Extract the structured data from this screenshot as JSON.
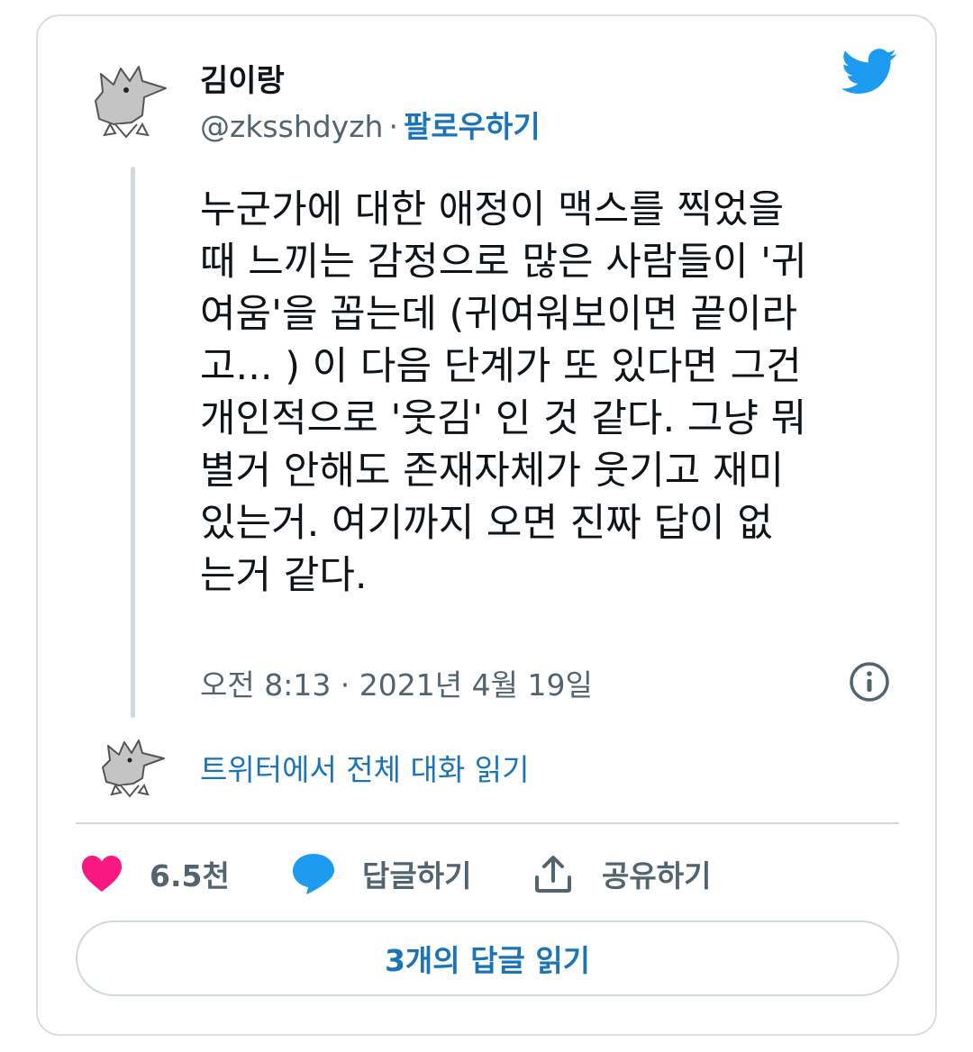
{
  "user": {
    "name": "김이랑",
    "handle": "@zksshdyzh",
    "separator": "·",
    "follow_label": "팔로우하기"
  },
  "tweet": {
    "lines": [
      "누군가에 대한 애정이 맥스를 찍었을",
      "때 느끼는 감정으로 많은 사람들이 '귀",
      "여움'을 꼽는데 (귀여워보이면 끝이라",
      "고... ) 이 다음 단계가 또  있다면 그건",
      "개인적으로 '웃김' 인 것 같다. 그냥 뭐",
      "별거 안해도 존재자체가 웃기고 재미",
      "있는거. 여기까지 오면 진짜 답이 없",
      "는거 같다."
    ],
    "timestamp": "오전 8:13 · 2021년 4월 19일"
  },
  "read_conversation_label": "트위터에서 전체 대화 읽기",
  "actions": {
    "like_count": "6.5천",
    "reply_label": "답글하기",
    "share_label": "공유하기"
  },
  "read_replies_label": "3개의 답글 읽기",
  "colors": {
    "accent": "#1b74b8",
    "twitter_blue": "#1d9bf0",
    "like_pink": "#f91880",
    "secondary_text": "#536471",
    "border": "#cfd9de"
  },
  "icons": {
    "brand": "twitter-bird-icon",
    "info": "info-icon",
    "like": "heart-icon",
    "reply": "speech-bubble-icon",
    "share": "share-upload-icon"
  }
}
